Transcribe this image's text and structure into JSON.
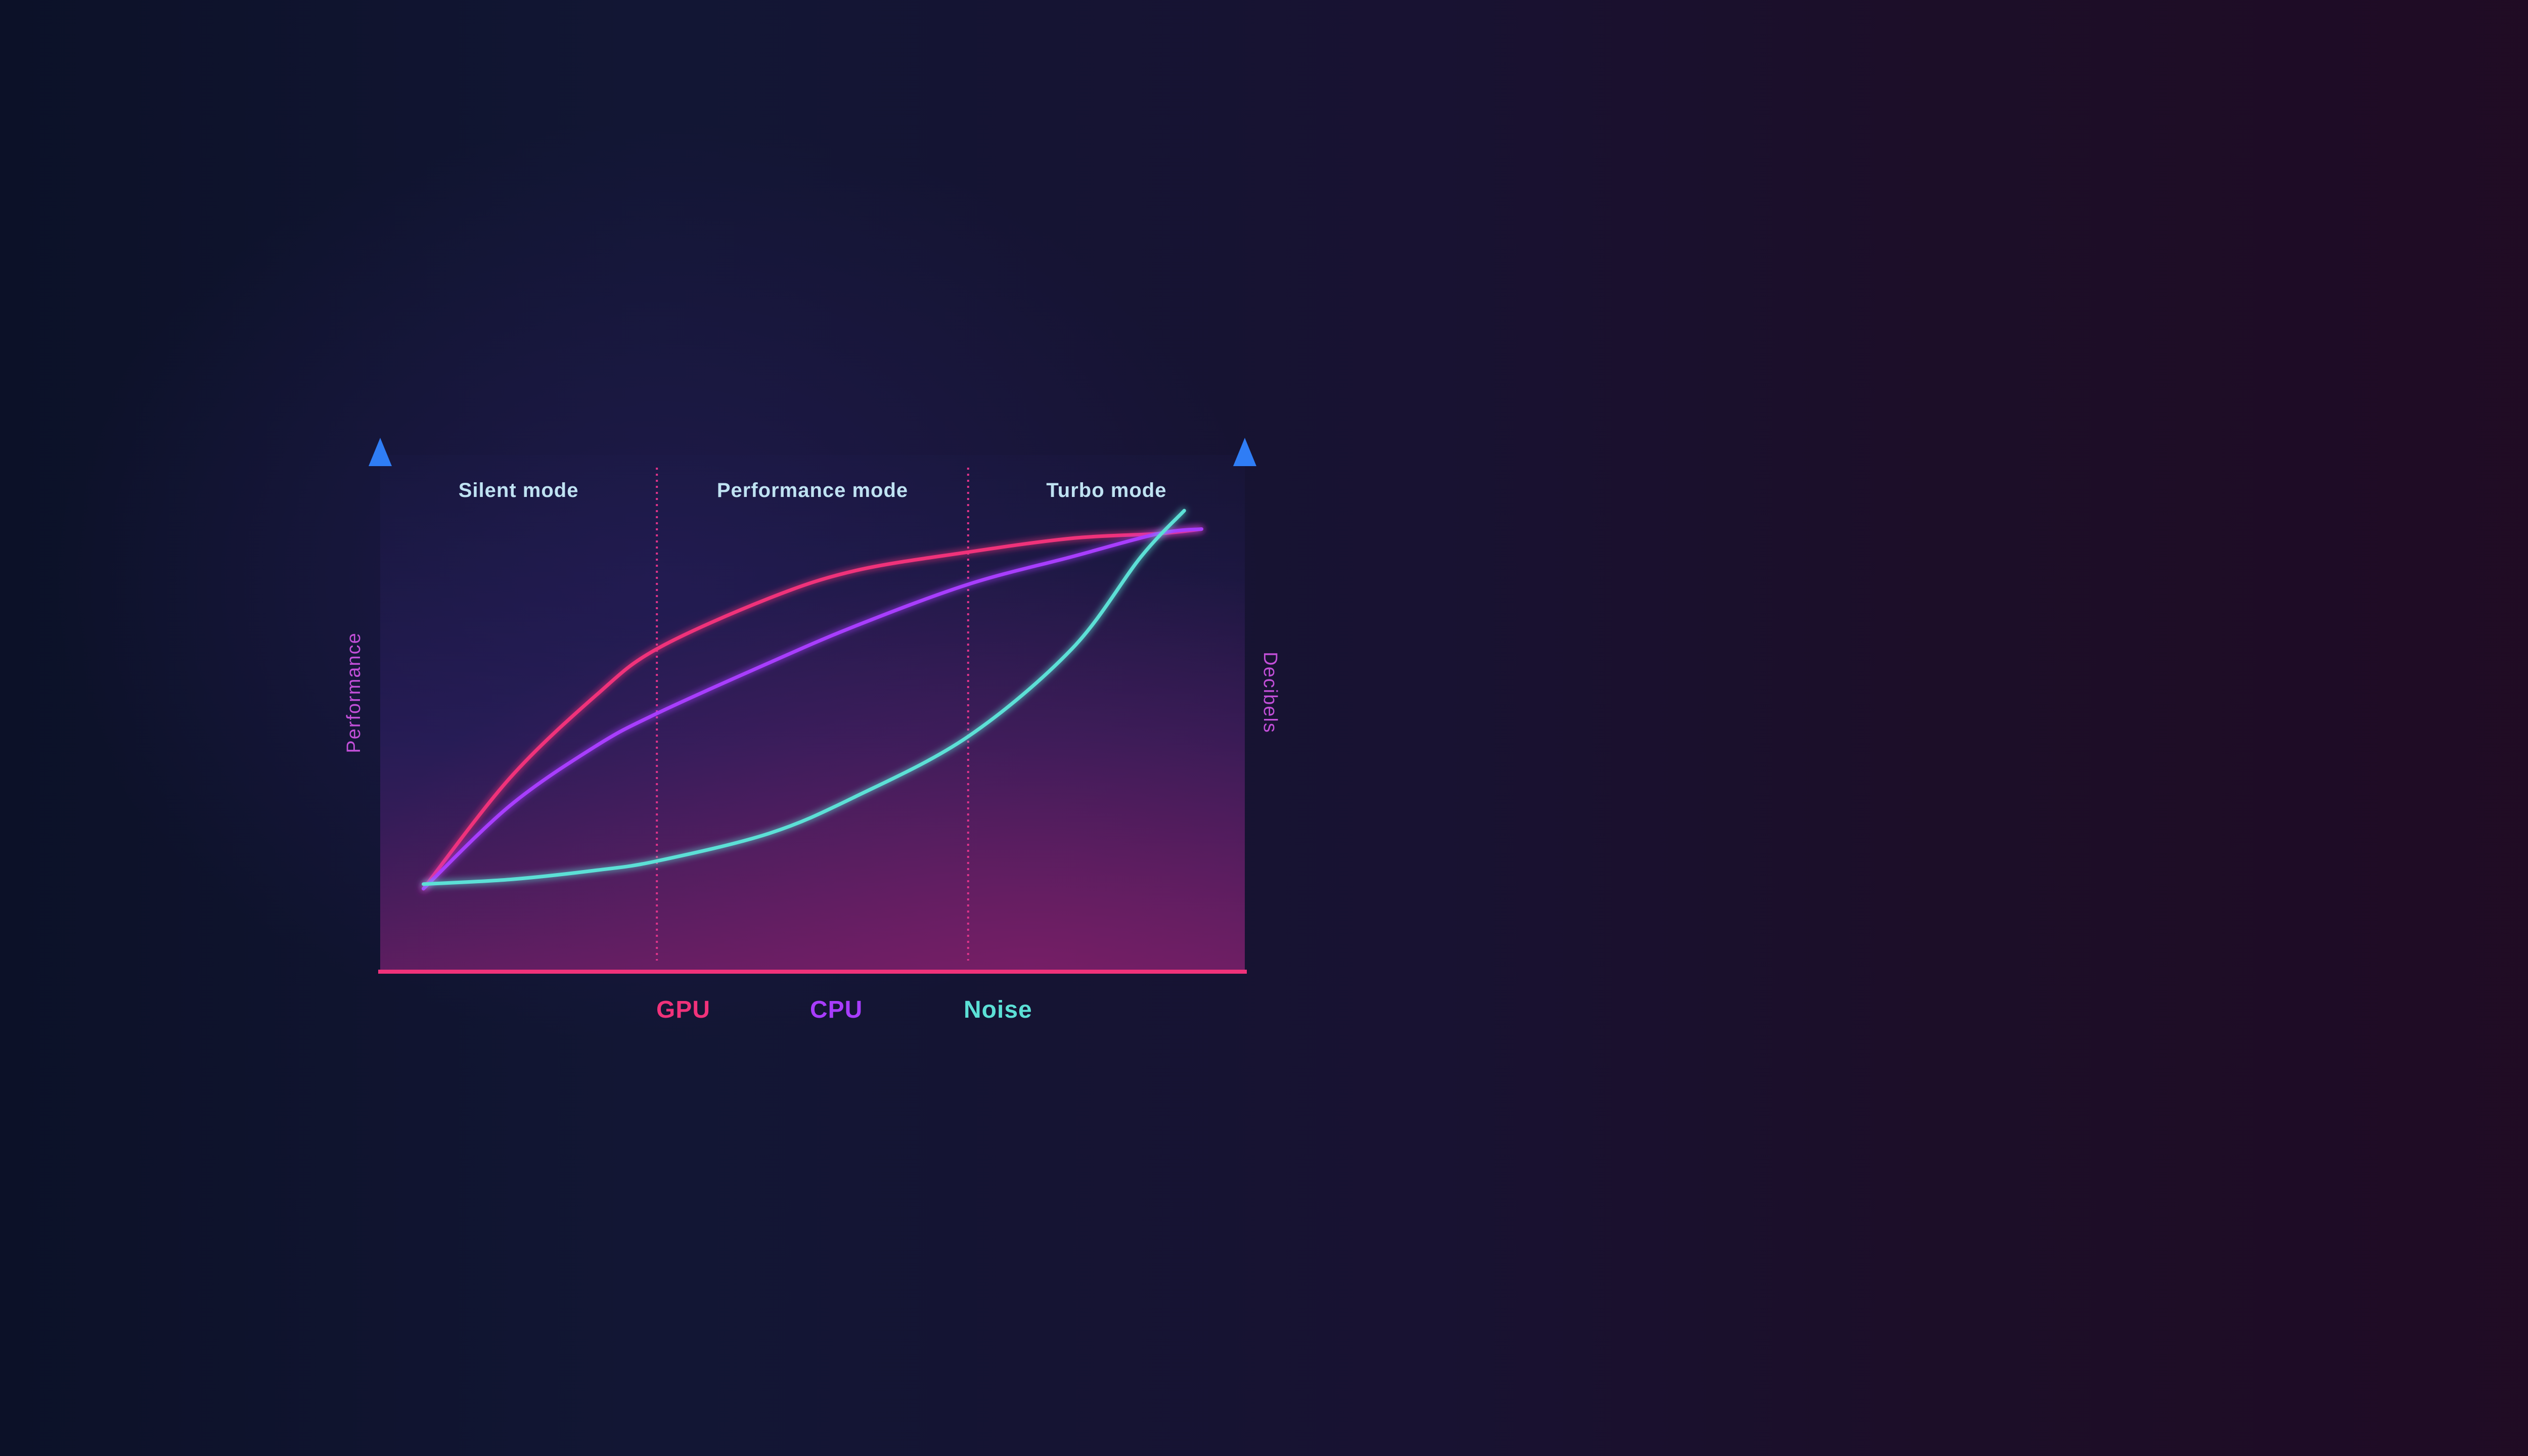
{
  "chart_data": {
    "type": "line",
    "title": "",
    "ylabel_left": "Performance",
    "ylabel_right": "Decibels",
    "xlabel": "",
    "x_range": [
      0,
      100
    ],
    "y_range": [
      0,
      100
    ],
    "zones": [
      {
        "label": "Silent mode",
        "x_start": 0,
        "x_end": 32
      },
      {
        "label": "Performance mode",
        "x_start": 32,
        "x_end": 68
      },
      {
        "label": "Turbo mode",
        "x_start": 68,
        "x_end": 100
      }
    ],
    "zone_dividers_x": [
      32,
      68
    ],
    "series": [
      {
        "name": "GPU",
        "color": "#f0327a",
        "points": [
          [
            5,
            18
          ],
          [
            15,
            42
          ],
          [
            25,
            60
          ],
          [
            32,
            70
          ],
          [
            45,
            81
          ],
          [
            55,
            87
          ],
          [
            68,
            91
          ],
          [
            80,
            94
          ],
          [
            90,
            95
          ],
          [
            95,
            96
          ]
        ]
      },
      {
        "name": "CPU",
        "color": "#a83cff",
        "points": [
          [
            5,
            18
          ],
          [
            15,
            36
          ],
          [
            25,
            49
          ],
          [
            32,
            56
          ],
          [
            45,
            67
          ],
          [
            55,
            75
          ],
          [
            68,
            84
          ],
          [
            80,
            90
          ],
          [
            90,
            95
          ],
          [
            95,
            96
          ]
        ]
      },
      {
        "name": "Noise",
        "color": "#5ce0d6",
        "points": [
          [
            5,
            19
          ],
          [
            15,
            20
          ],
          [
            25,
            22
          ],
          [
            32,
            24
          ],
          [
            45,
            30
          ],
          [
            55,
            38
          ],
          [
            68,
            51
          ],
          [
            80,
            70
          ],
          [
            88,
            90
          ],
          [
            93,
            100
          ]
        ]
      }
    ],
    "grid": false,
    "legend_position": "bottom-center"
  },
  "legend": {
    "gpu_label": "GPU",
    "cpu_label": "CPU",
    "noise_label": "Noise",
    "gpu_color": "#f0327a",
    "cpu_color": "#a83cff",
    "noise_color": "#5ce0d6"
  }
}
